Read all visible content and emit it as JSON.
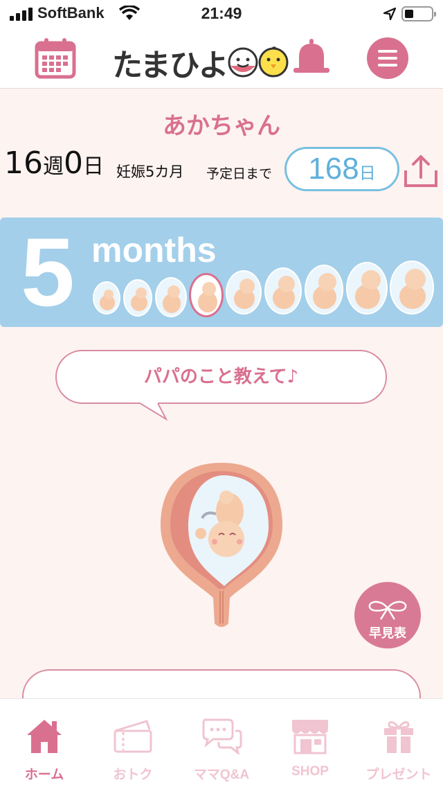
{
  "status_bar": {
    "carrier": "SoftBank",
    "time": "21:49"
  },
  "header": {
    "logo_text": "たまひよ",
    "icons": [
      "calendar-icon",
      "bell-icon",
      "menu-icon"
    ]
  },
  "pregnancy": {
    "baby_name": "あかちゃん",
    "weeks": "16",
    "weeks_unit": "週",
    "days": "0",
    "days_unit": "日",
    "month_label": "妊娠5カ月",
    "until_due_label": "予定日まで",
    "days_until_due": "168",
    "days_until_due_unit": "日"
  },
  "months_band": {
    "number": "5",
    "label": "months",
    "selected_index": 3
  },
  "speech_bubble": {
    "text": "パパのこと教えて♪"
  },
  "quick_table": {
    "label": "早見表"
  },
  "tab_bar": {
    "tabs": [
      {
        "label": "ホーム",
        "icon": "home-icon",
        "active": true
      },
      {
        "label": "おトク",
        "icon": "coupon-icon",
        "active": false
      },
      {
        "label": "ママQ&A",
        "icon": "chat-icon",
        "active": false
      },
      {
        "label": "SHOP",
        "icon": "shop-icon",
        "active": false
      },
      {
        "label": "プレゼント",
        "icon": "gift-icon",
        "active": false
      }
    ]
  },
  "colors": {
    "accent": "#d9708f",
    "band": "#a3cfea",
    "days_blue": "#5fb1da",
    "background": "#fdf3f1"
  }
}
